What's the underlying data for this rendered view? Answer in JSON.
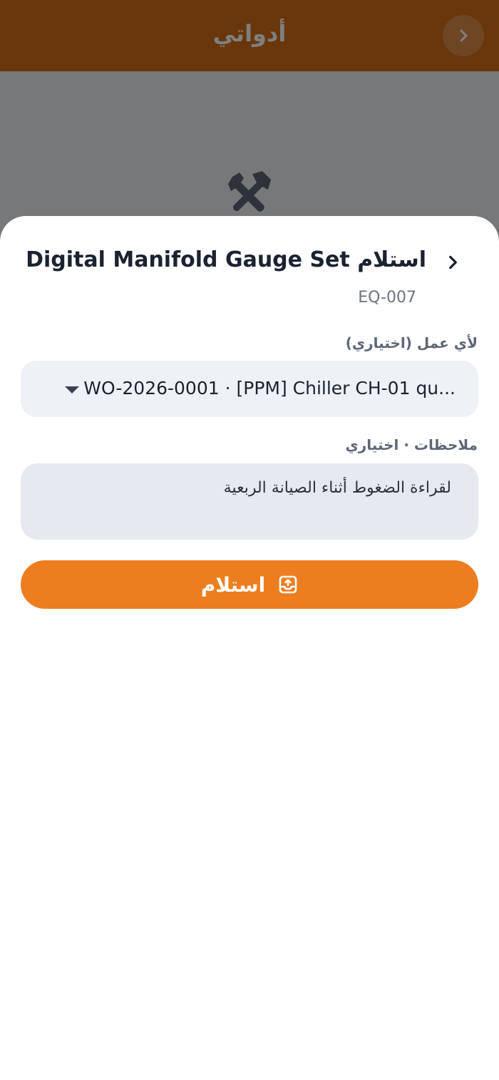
{
  "header": {
    "title": "أدواتي"
  },
  "sheet": {
    "title": "استلام Digital Manifold Gauge Set",
    "equipment_code": "EQ-007",
    "job_label": "لأي عمل (اختياري)",
    "job_selected": "WO-2026-0001 · [PPM] Chiller CH-01 qu...",
    "notes_label": "ملاحظات · اختياري",
    "notes_value": "لقراءة الضغوط أثناء الصيانة الربعية",
    "submit_label": "استلام"
  },
  "icons": {
    "header_back": "chevron-right-icon",
    "sheet_back": "chevron-right-icon",
    "tools": "tools-icon",
    "submit": "tray-upload-icon"
  },
  "colors": {
    "header": "#d46c17",
    "accent": "#ed7e1f",
    "text_dark": "#1b2230"
  }
}
